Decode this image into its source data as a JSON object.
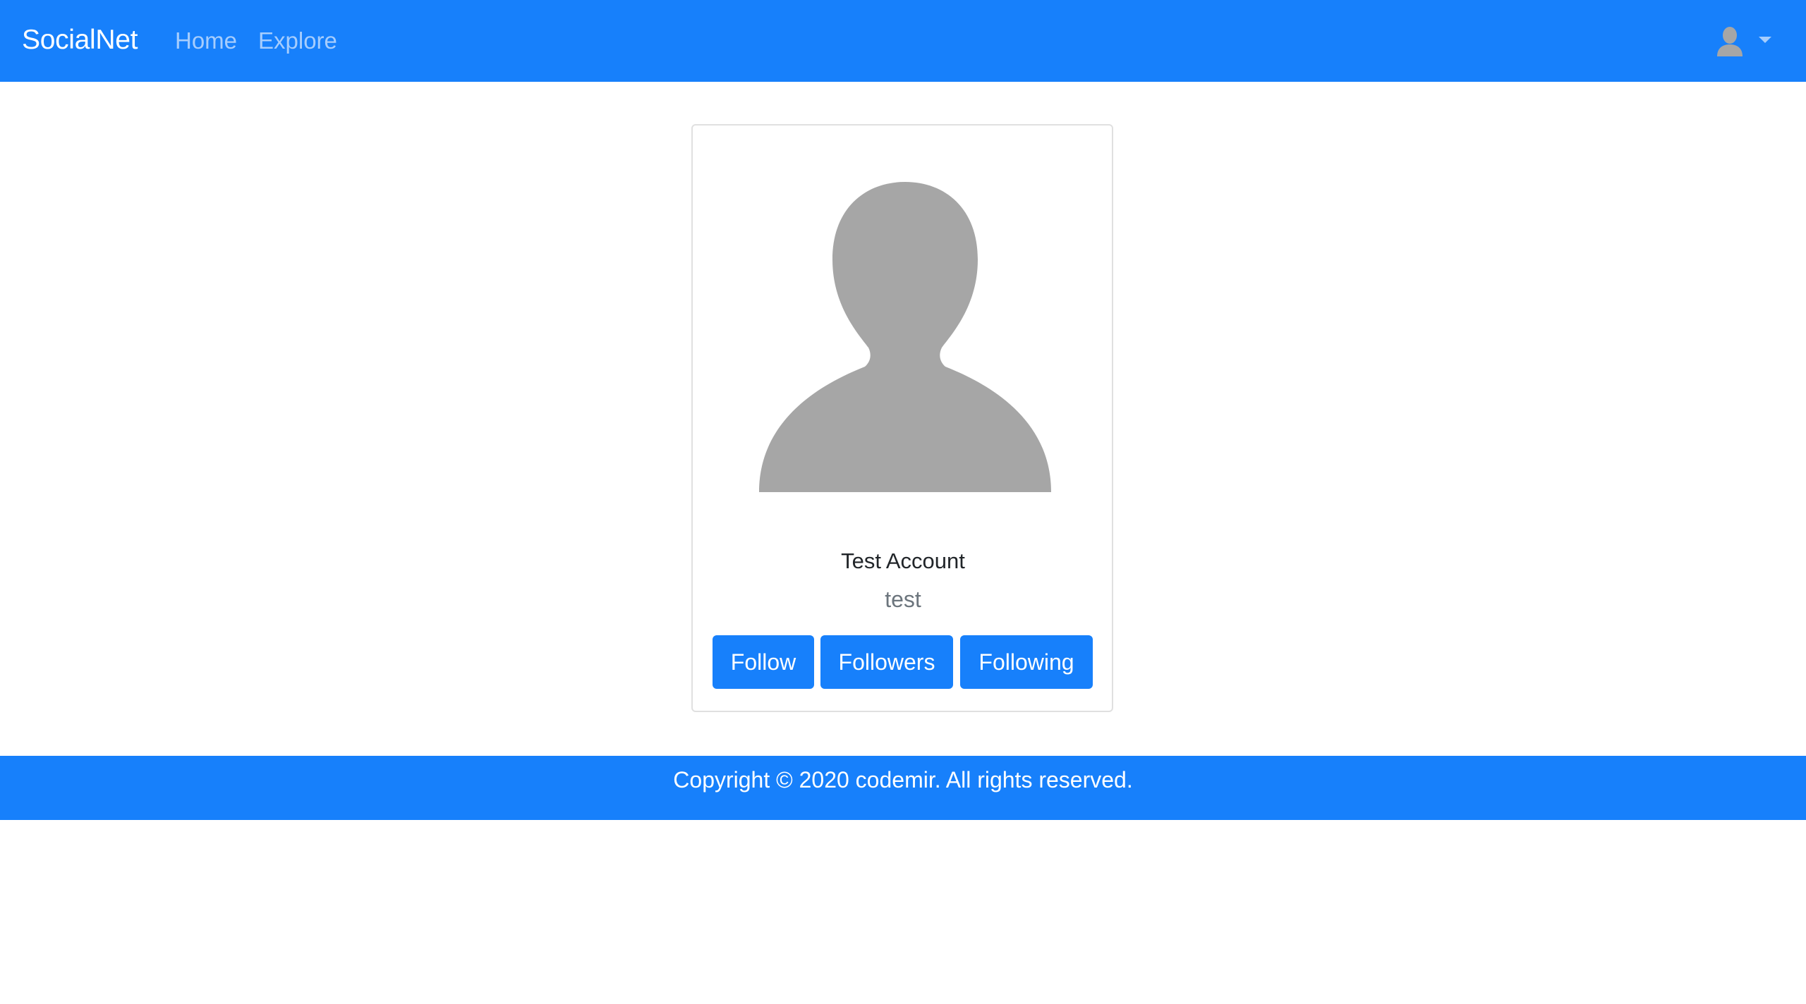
{
  "navbar": {
    "brand": "SocialNet",
    "links": [
      {
        "label": "Home"
      },
      {
        "label": "Explore"
      }
    ],
    "user_menu_icon": "user-icon",
    "dropdown_icon": "caret-down-icon"
  },
  "profile": {
    "avatar_icon": "default-avatar-silhouette",
    "name": "Test Account",
    "username": "test",
    "buttons": {
      "follow": "Follow",
      "followers": "Followers",
      "following": "Following"
    }
  },
  "footer": {
    "text": "Copyright © 2020 codemir. All rights reserved."
  },
  "colors": {
    "primary": "#1780fb",
    "nav_link": "#a6cdfd",
    "avatar_gray": "#a6a6a6",
    "muted_text": "#6c757d"
  }
}
